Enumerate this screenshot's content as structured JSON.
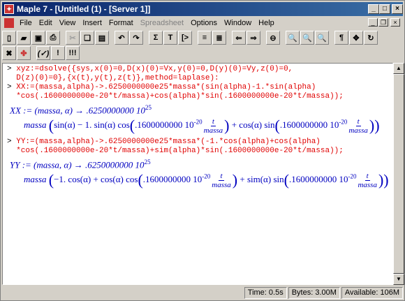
{
  "title": "Maple 7 - [Untitled (1) - [Server 1]]",
  "menu": [
    "File",
    "Edit",
    "View",
    "Insert",
    "Format",
    "Spreadsheet",
    "Options",
    "Window",
    "Help"
  ],
  "commands": [
    "xyz:=dsolve({sys,x(0)=0,D(x)(0)=Vx,y(0)=0,D(y)(0)=Vy,z(0)=0,",
    "D(z)(0)=0},{x(t),y(t),z(t)},method=laplase):",
    "XX:=(massa,alpha)->.6250000000e25*massa*(sin(alpha)-1.*sin(alpha)",
    "*cos(.1600000000e-20*t/massa)+cos(alpha)*sin(.1600000000e-20*t/massa));",
    "YY:=(massa,alpha)->.6250000000e25*massa*(-1.*cos(alpha)+cos(alpha)",
    "*cos(.1600000000e-20*t/massa)+sim(alpha)*sin(.1600000000e-20*t/massa));"
  ],
  "prompt": ">",
  "xx_out": {
    "head": "XX := (massa, α) → .6250000000 10",
    "exp": "25",
    "l2a": "massa ",
    "l2b": "sin(α) − 1. sin(α) cos",
    "l2c": ".1600000000 10",
    "l2exp": "-20",
    "t": "t",
    "massa": "massa",
    "l2d": "+ cos(α) sin",
    "l2e": ".1600000000 10",
    "l2exp2": "-20"
  },
  "yy_out": {
    "head": "YY := (massa, α) → .6250000000 10",
    "exp": "25",
    "l2a": "massa ",
    "l2b": "−1. cos(α) + cos(α) cos",
    "l2c": ".1600000000 10",
    "l2exp": "-20",
    "t": "t",
    "massa": "massa",
    "l2d": "+ sim(α) sin",
    "l2e": ".1600000000 10",
    "l2exp2": "-20"
  },
  "status": {
    "time": "Time:  0.5s",
    "bytes": "Bytes: 3.00M",
    "avail": "Available: 106M"
  }
}
